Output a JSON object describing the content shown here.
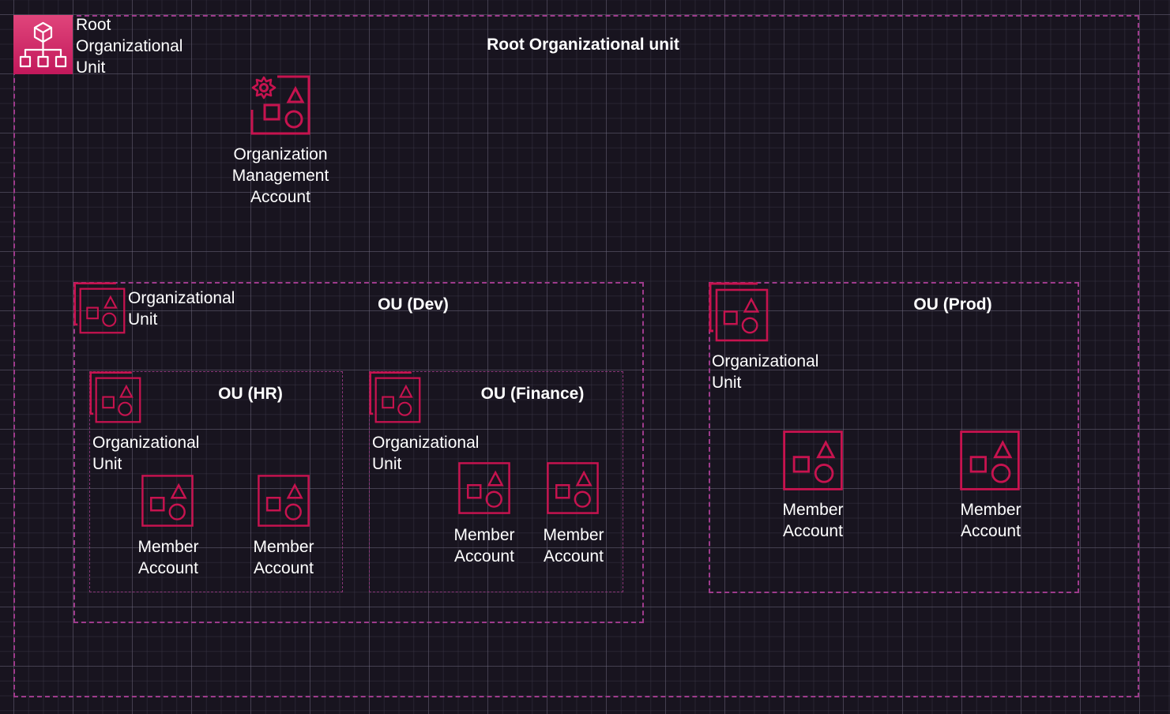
{
  "diagram": {
    "accent_color": "#c7134f",
    "root_badge_color": "#d6336b",
    "group_border_color": "#9e3b8c",
    "root": {
      "title": "Root Organizational unit",
      "icon": "organizations-icon",
      "icon_label_lines": [
        "Root",
        "Organizational",
        "Unit"
      ],
      "management_account": {
        "icon": "management-account-icon",
        "label_lines": [
          "Organization",
          "Management",
          "Account"
        ]
      }
    },
    "ou_dev": {
      "title": "OU (Dev)",
      "icon": "organizational-unit-icon",
      "icon_label_lines": [
        "Organizational",
        "Unit"
      ],
      "children": {
        "ou_hr": {
          "title": "OU (HR)",
          "icon_label_lines": [
            "Organizational",
            "Unit"
          ],
          "accounts": [
            {
              "label_lines": [
                "Member",
                "Account"
              ]
            },
            {
              "label_lines": [
                "Member",
                "Account"
              ]
            }
          ]
        },
        "ou_finance": {
          "title": "OU (Finance)",
          "icon_label_lines": [
            "Organizational",
            "Unit"
          ],
          "accounts": [
            {
              "label_lines": [
                "Member",
                "Account"
              ]
            },
            {
              "label_lines": [
                "Member",
                "Account"
              ]
            }
          ]
        }
      }
    },
    "ou_prod": {
      "title": "OU (Prod)",
      "icon_label_lines": [
        "Organizational",
        "Unit"
      ],
      "accounts": [
        {
          "label_lines": [
            "Member",
            "Account"
          ]
        },
        {
          "label_lines": [
            "Member",
            "Account"
          ]
        }
      ]
    }
  }
}
